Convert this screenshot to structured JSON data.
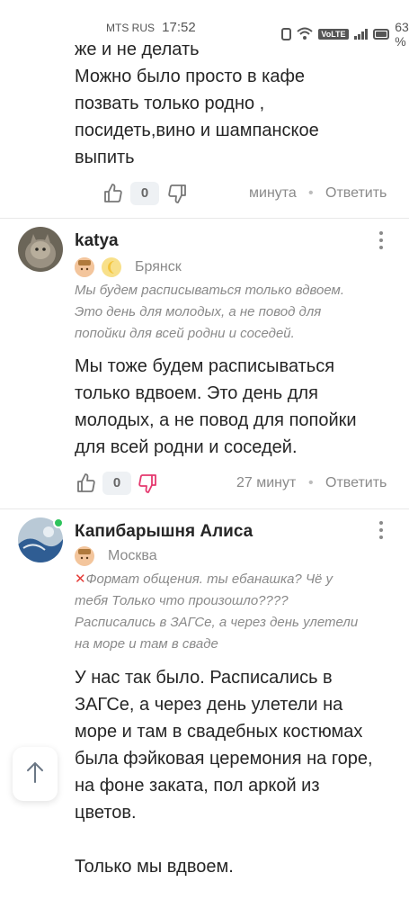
{
  "status_bar": {
    "carrier": "MTS RUS",
    "time": "17:52",
    "volte": "VoLTE",
    "battery": "63 %"
  },
  "comments": [
    {
      "body_lines": [
        "же и не делать",
        "Можно было просто в кафе",
        "позвать только родно ,",
        "посидеть,вино и шампанское",
        "выпить"
      ],
      "votes": "0",
      "time": "минута",
      "reply": "Ответить"
    },
    {
      "author": "katya",
      "city": "Брянск",
      "quote_lines": [
        "Мы будем расписываться только вдвоем.",
        "Это день для молодых, а не повод для",
        "попойки для всей родни и соседей."
      ],
      "body_lines": [
        "Мы тоже будем расписываться",
        "только вдвоем. Это день для",
        "молодых, а не повод для попойки",
        "для всей родни и соседей."
      ],
      "votes": "0",
      "time": "27 минут",
      "reply": "Ответить"
    },
    {
      "author": "Капибарышня Алиса",
      "city": "Москва",
      "quote_lines": [
        "Формат общения. ты ебанашка? Чё у",
        "тебя Только что произошло????",
        "Расписались в ЗАГСе, а через день улетели",
        "на море и там в сваде"
      ],
      "body_lines": [
        "У нас так было. Расписались в",
        "ЗАГСе, а через день улетели на",
        "море и там в свадебных костюмах",
        "была фэйковая церемония на горе,",
        "на фоне заката, пол аркой из",
        "цветов.",
        "",
        "Только мы вдвоем."
      ]
    }
  ],
  "icons": {
    "like": "thumbs-up-icon",
    "dislike": "thumbs-down-icon",
    "more": "more-vertical-icon",
    "scroll_top": "arrow-up-icon",
    "cross": "red-cross-icon"
  },
  "colors": {
    "dislike_active": "#e5396f",
    "online": "#2ec35c",
    "meta_grey": "#8a8a8a"
  }
}
